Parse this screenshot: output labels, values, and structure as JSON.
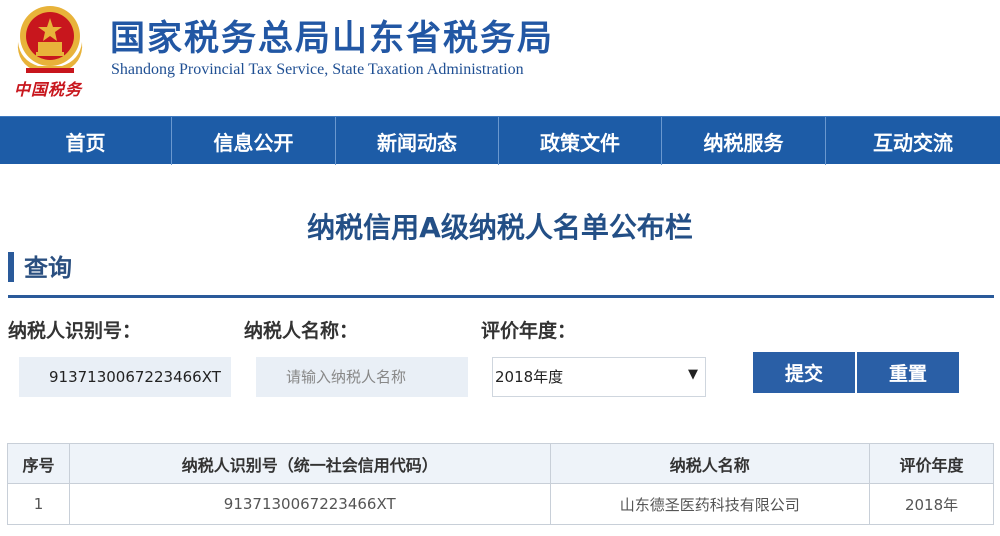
{
  "header": {
    "title": "国家税务总局山东省税务局",
    "subtitle": "Shandong Provincial Tax Service, State Taxation Administration",
    "emblem_caption": "中国税务"
  },
  "nav": {
    "items": [
      {
        "label": "首页"
      },
      {
        "label": "信息公开"
      },
      {
        "label": "新闻动态"
      },
      {
        "label": "政策文件"
      },
      {
        "label": "纳税服务"
      },
      {
        "label": "互动交流"
      }
    ]
  },
  "page": {
    "title": "纳税信用A级纳税人名单公布栏"
  },
  "query": {
    "section_label": "查询",
    "taxpayer_id_label": "纳税人识别号：",
    "taxpayer_id_value": "9137130067223466XT",
    "taxpayer_name_label": "纳税人名称：",
    "taxpayer_name_placeholder": "请输入纳税人名称",
    "year_label": "评价年度：",
    "year_selected": "2018年度",
    "submit_label": "提交",
    "reset_label": "重置"
  },
  "table": {
    "headers": [
      "序号",
      "纳税人识别号（统一社会信用代码）",
      "纳税人名称",
      "评价年度"
    ],
    "rows": [
      [
        "1",
        "9137130067223466XT",
        "山东德圣医药科技有限公司",
        "2018年"
      ]
    ]
  },
  "colors": {
    "brand_blue": "#1d5ca7",
    "title_blue": "#2257a4",
    "emblem_red": "#c8161d",
    "emblem_gold": "#e8b33a"
  },
  "icons": {
    "emblem": "national-emblem-icon",
    "select_arrow": "chevron-down-icon"
  }
}
